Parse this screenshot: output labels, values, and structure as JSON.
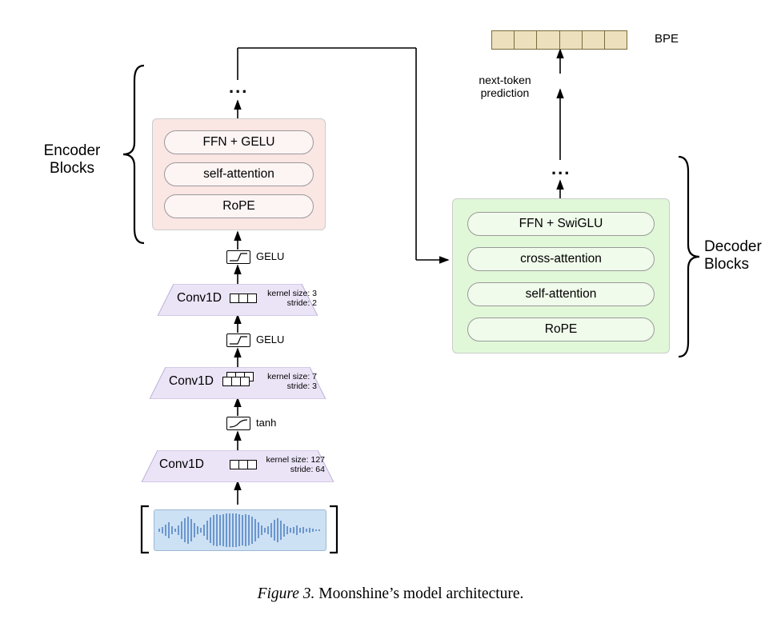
{
  "encoder": {
    "label": "Encoder\nBlocks",
    "items": [
      "FFN + GELU",
      "self-attention",
      "RoPE"
    ],
    "ellipsis": "..."
  },
  "decoder": {
    "label": "Decoder\nBlocks",
    "items": [
      "FFN + SwiGLU",
      "cross-attention",
      "self-attention",
      "RoPE"
    ],
    "ellipsis": "..."
  },
  "conv_stack": [
    {
      "name": "Conv1D",
      "activation": "GELU",
      "kernel_label": "kernel size: 3\nstride: 2",
      "boxes": 3
    },
    {
      "name": "Conv1D",
      "activation": "GELU",
      "kernel_label": "kernel size: 7\nstride: 3",
      "boxes": 5,
      "staggered": true
    },
    {
      "name": "Conv1D",
      "activation": "tanh",
      "kernel_label": "kernel size: 127\nstride: 64",
      "boxes": 3
    }
  ],
  "bpe": {
    "label": "BPE",
    "cells": 6
  },
  "next_token": "next-token\nprediction",
  "caption_prefix": "Figure 3.",
  "caption_rest": " Moonshine’s model architecture."
}
